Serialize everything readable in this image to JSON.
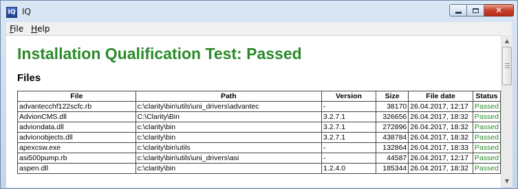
{
  "window": {
    "title": "IQ",
    "icon": "iq-app-icon",
    "icon_text": "IQ"
  },
  "menu": [
    {
      "underline": "F",
      "rest": "ile"
    },
    {
      "underline": "H",
      "rest": "elp"
    }
  ],
  "caption_buttons": {
    "minimize": "minimize-icon",
    "maximize": "maximize-icon",
    "close": "✕"
  },
  "report": {
    "heading": "Installation Qualification Test: Passed",
    "section": "Files",
    "columns": [
      "File",
      "Path",
      "Version",
      "Size",
      "File date",
      "Status"
    ],
    "rows": [
      [
        "advantecchf122scfc.rb",
        "c:\\clarity\\bin\\utils\\uni_drivers\\advantec",
        "-",
        "38170",
        "26.04.2017, 12:17",
        "Passed"
      ],
      [
        "AdvionCMS.dll",
        "C:\\Clarity\\Bin",
        "3.2.7.1",
        "326656",
        "26.04.2017, 18:32",
        "Passed"
      ],
      [
        "adviondata.dll",
        "c:\\clarity\\bin",
        "3.2.7.1",
        "272896",
        "26.04.2017, 18:32",
        "Passed"
      ],
      [
        "advionobjects.dll",
        "c:\\clarity\\bin",
        "3.2.7.1",
        "438784",
        "26.04.2017, 18:32",
        "Passed"
      ],
      [
        "apexcsw.exe",
        "c:\\clarity\\bin\\utils",
        "-",
        "132864",
        "26.04.2017, 18:33",
        "Passed"
      ],
      [
        "asi500pump.rb",
        "c:\\clarity\\bin\\utils\\uni_drivers\\asi",
        "-",
        "44587",
        "26.04.2017, 12:17",
        "Passed"
      ],
      [
        "aspen.dll",
        "c:\\clarity\\bin",
        "1.2.4.0",
        "185344",
        "26.04.2017, 18:32",
        "Passed"
      ]
    ]
  },
  "scrollbar": {
    "up": "▲",
    "down": "▼"
  }
}
